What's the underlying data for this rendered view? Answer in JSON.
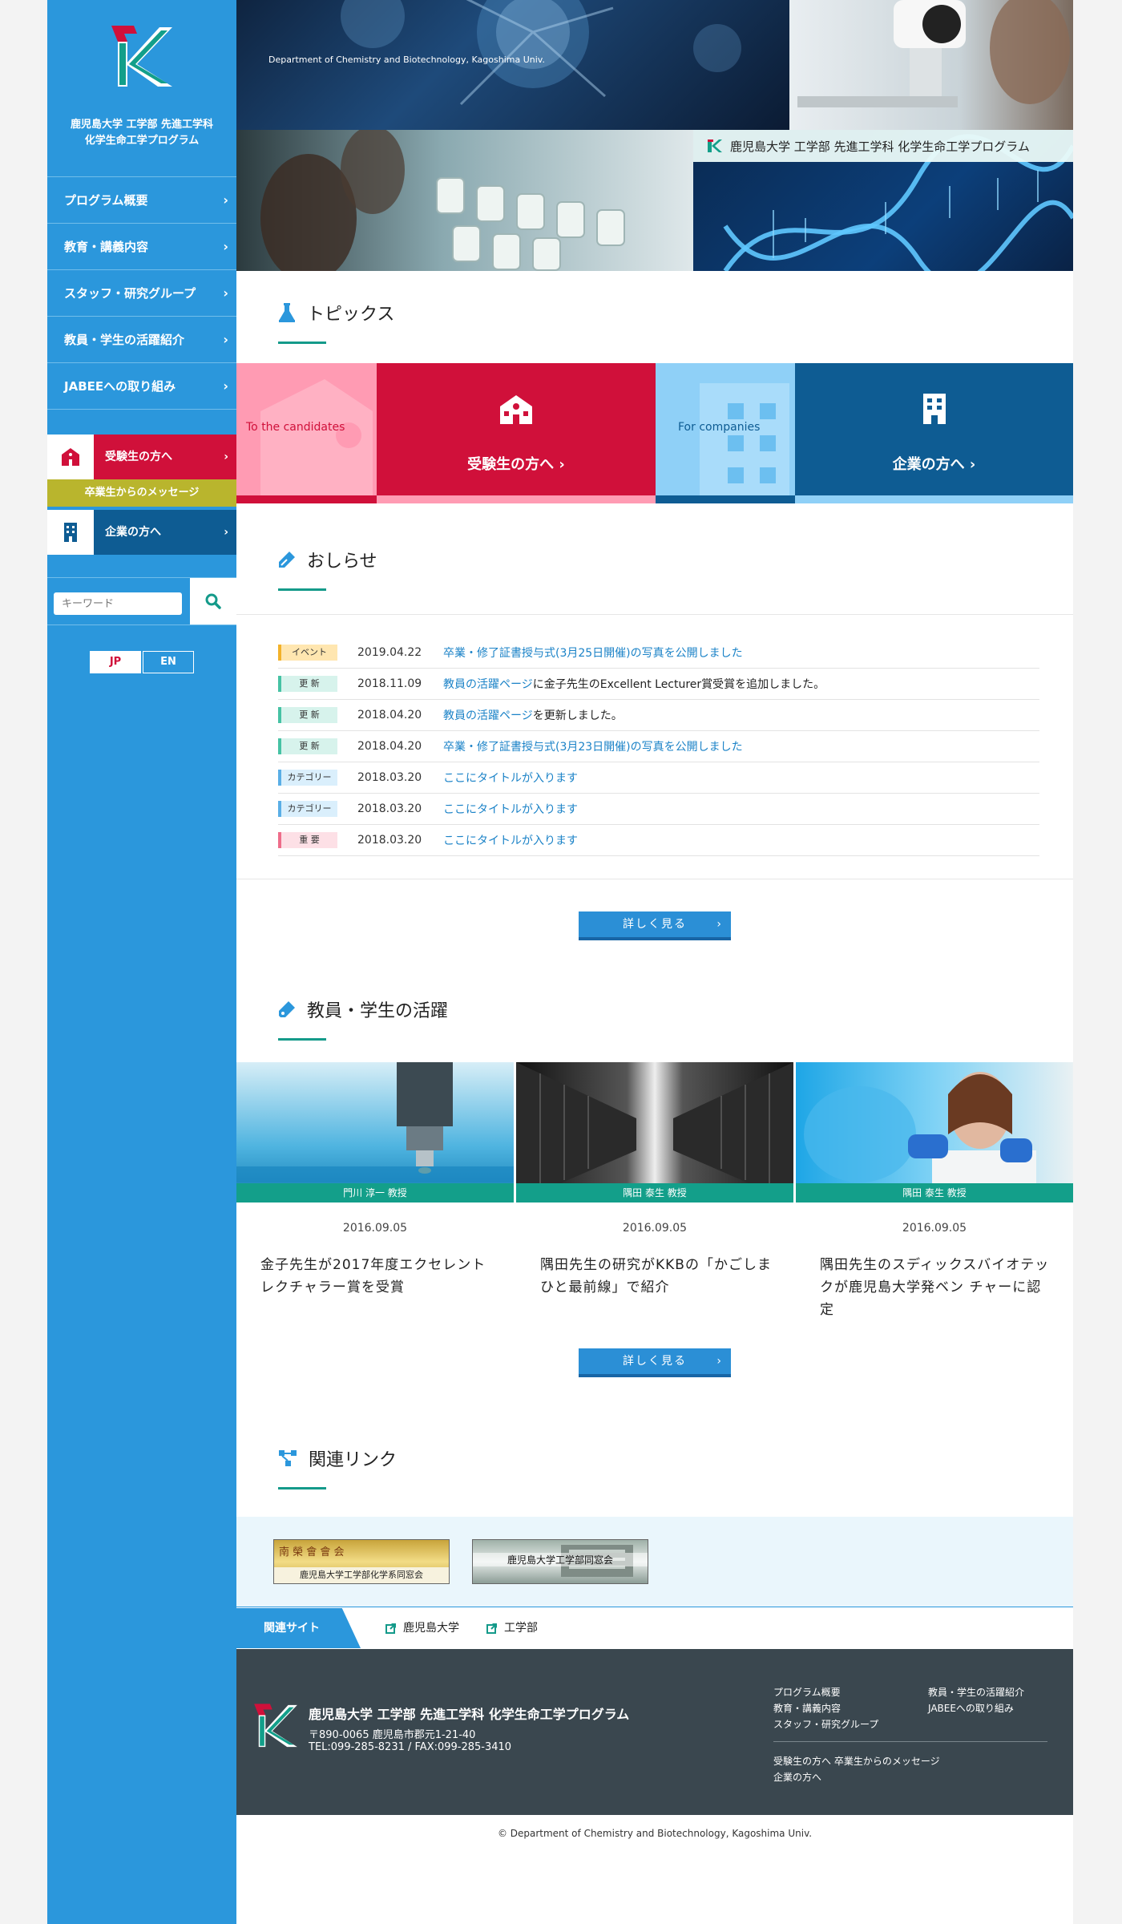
{
  "site": {
    "name_line1": "鹿児島大学 工学部 先進工学科",
    "name_line2": "化学生命工学プログラム",
    "hero_en": "Department of Chemistry and Biotechnology, Kagoshima Univ.",
    "hero_badge": "鹿児島大学 工学部 先進工学科 化学生命工学プログラム"
  },
  "nav": [
    {
      "label": "プログラム概要"
    },
    {
      "label": "教育・講義内容"
    },
    {
      "label": "スタッフ・研究グループ"
    },
    {
      "label": "教員・学生の活躍紹介"
    },
    {
      "label": "JABEEへの取り組み"
    }
  ],
  "side_cta": {
    "candidates": "受験生の方へ",
    "graduates_msg": "卒業生からのメッセージ",
    "companies": "企業の方へ"
  },
  "search": {
    "placeholder": "キーワード"
  },
  "lang": {
    "jp": "JP",
    "en": "EN"
  },
  "topics": {
    "title": "トピックス",
    "candidates_en": "To the candidates",
    "candidates_jp": "受験生の方へ",
    "companies_en": "For companies",
    "companies_jp": "企業の方へ"
  },
  "news": {
    "title": "おしらせ",
    "items": [
      {
        "tag": "イベント",
        "date": "2019.04.22",
        "link": "卒業・修了証書授与式(3月25日開催)の写真を公開しました",
        "rest": ""
      },
      {
        "tag": "更 新",
        "date": "2018.11.09",
        "link": "教員の活躍ページ",
        "rest": "に金子先生のExcellent Lecturer賞受賞を追加しました。"
      },
      {
        "tag": "更 新",
        "date": "2018.04.20",
        "link": "教員の活躍ページ",
        "rest": "を更新しました。"
      },
      {
        "tag": "更 新",
        "date": "2018.04.20",
        "link": "卒業・修了証書授与式(3月23日開催)の写真を公開しました",
        "rest": ""
      },
      {
        "tag": "カテゴリー",
        "date": "2018.03.20",
        "link": "ここにタイトルが入ります",
        "rest": ""
      },
      {
        "tag": "カテゴリー",
        "date": "2018.03.20",
        "link": "ここにタイトルが入ります",
        "rest": ""
      },
      {
        "tag": "重 要",
        "date": "2018.03.20",
        "link": "ここにタイトルが入ります",
        "rest": ""
      }
    ],
    "more": "詳しく見る"
  },
  "activities": {
    "title": "教員・学生の活躍",
    "cards": [
      {
        "caption": "門川 淳一 教授",
        "date": "2016.09.05",
        "title": "金子先生が2017年度エクセレントレクチャラー賞を受賞"
      },
      {
        "caption": "隅田 泰生 教授",
        "date": "2016.09.05",
        "title": "隅田先生の研究がKKBの「かごしまひと最前線」で紹介"
      },
      {
        "caption": "隅田 泰生 教授",
        "date": "2016.09.05",
        "title": "隅田先生のスディックスバイオテックが鹿児島大学発ベン チャーに認定"
      }
    ],
    "more": "詳しく見る"
  },
  "links": {
    "title": "関連リンク",
    "banner1_top": "南 榮 會 會 会",
    "banner1_bottom": "鹿児島大学工学部化学系同窓会",
    "banner2": "鹿児島大学工学部同窓会",
    "related_label": "関連サイト",
    "related": [
      "鹿児島大学",
      "工学部"
    ]
  },
  "footer": {
    "name": "鹿児島大学 工学部 先進工学科 化学生命工学プログラム",
    "address": "〒890-0065 鹿児島市郡元1-21-40",
    "tel": "TEL:099-285-8231 / FAX:099-285-3410",
    "col1": [
      "プログラム概要",
      "教育・講義内容",
      "スタッフ・研究グループ"
    ],
    "col2": [
      "教員・学生の活躍紹介",
      "JABEEへの取り組み"
    ],
    "bottom1": "受験生の方へ  卒業生からのメッセージ",
    "bottom2": "企業の方へ"
  },
  "copyright": "©  Department of Chemistry and Biotechnology, Kagoshima Univ.",
  "colors": {
    "brand_blue": "#2b97dc",
    "candidates_red": "#d0103a",
    "companies_navy": "#0e5c93",
    "accent_green": "#149a8a"
  }
}
